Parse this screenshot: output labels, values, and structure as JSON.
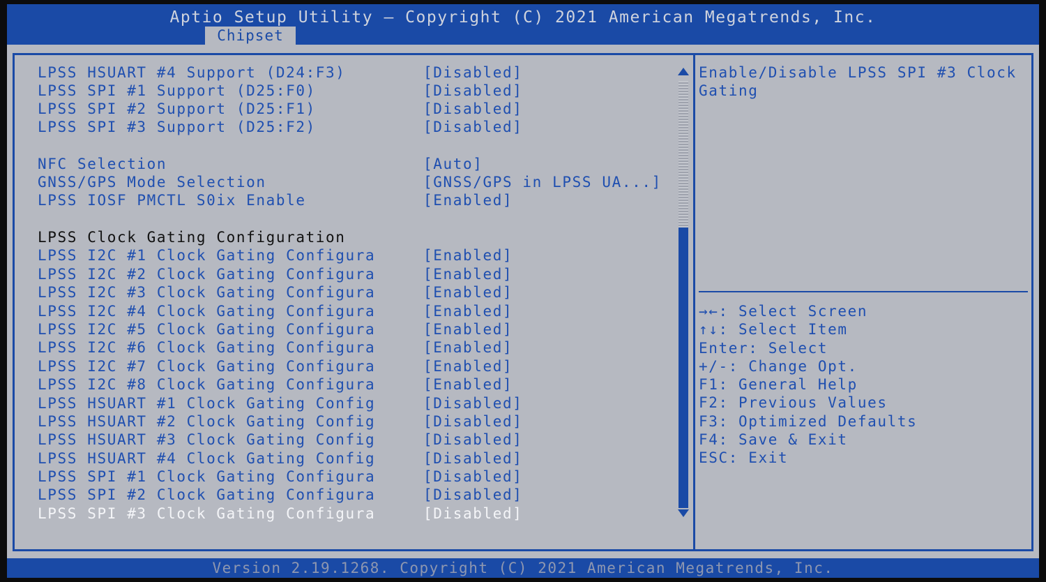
{
  "header": {
    "title": "Aptio Setup Utility – Copyright (C) 2021 American Megatrends, Inc.",
    "tab": "Chipset"
  },
  "rows": [
    {
      "label": "LPSS HSUART #4 Support (D24:F3)",
      "value": "[Disabled]"
    },
    {
      "label": "LPSS SPI #1 Support (D25:F0)",
      "value": "[Disabled]"
    },
    {
      "label": "LPSS SPI #2 Support (D25:F1)",
      "value": "[Disabled]"
    },
    {
      "label": "LPSS SPI #3 Support (D25:F2)",
      "value": "[Disabled]"
    },
    {
      "label": "NFC Selection",
      "value": "[Auto]"
    },
    {
      "label": "GNSS/GPS Mode Selection",
      "value": "[GNSS/GPS in LPSS UA...]"
    },
    {
      "label": "LPSS IOSF PMCTL S0ix Enable",
      "value": "[Enabled]"
    },
    {
      "label": "LPSS Clock Gating Configuration",
      "value": ""
    },
    {
      "label": "LPSS I2C #1 Clock Gating Configura",
      "value": "[Enabled]"
    },
    {
      "label": "LPSS I2C #2 Clock Gating Configura",
      "value": "[Enabled]"
    },
    {
      "label": "LPSS I2C #3 Clock Gating Configura",
      "value": "[Enabled]"
    },
    {
      "label": "LPSS I2C #4 Clock Gating Configura",
      "value": "[Enabled]"
    },
    {
      "label": "LPSS I2C #5 Clock Gating Configura",
      "value": "[Enabled]"
    },
    {
      "label": "LPSS I2C #6 Clock Gating Configura",
      "value": "[Enabled]"
    },
    {
      "label": "LPSS I2C #7 Clock Gating Configura",
      "value": "[Enabled]"
    },
    {
      "label": "LPSS I2C #8 Clock Gating Configura",
      "value": "[Enabled]"
    },
    {
      "label": "LPSS HSUART #1 Clock Gating Config",
      "value": "[Disabled]"
    },
    {
      "label": "LPSS HSUART #2 Clock Gating Config",
      "value": "[Disabled]"
    },
    {
      "label": "LPSS HSUART #3 Clock Gating Config",
      "value": "[Disabled]"
    },
    {
      "label": "LPSS HSUART #4 Clock Gating Config",
      "value": "[Disabled]"
    },
    {
      "label": "LPSS SPI #1 Clock Gating Configura",
      "value": "[Disabled]"
    },
    {
      "label": "LPSS SPI #2 Clock Gating Configura",
      "value": "[Disabled]"
    },
    {
      "label": "LPSS SPI #3 Clock Gating Configura",
      "value": "[Disabled]"
    }
  ],
  "help_text": "Enable/Disable LPSS SPI #3 Clock Gating",
  "keys": [
    "→←: Select Screen",
    "↑↓: Select Item",
    "Enter: Select",
    "+/-: Change Opt.",
    "F1: General Help",
    "F2: Previous Values",
    "F3: Optimized Defaults",
    "F4: Save & Exit",
    "ESC: Exit"
  ],
  "footer": "Version 2.19.1268. Copyright (C) 2021 American Megatrends, Inc.",
  "colors": {
    "accent": "#1a4aa6",
    "background": "#b6b9c1",
    "text": "#1f4fb0"
  },
  "icons": {
    "scroll_up": "triangle-up-icon",
    "scroll_down": "triangle-down-icon"
  }
}
